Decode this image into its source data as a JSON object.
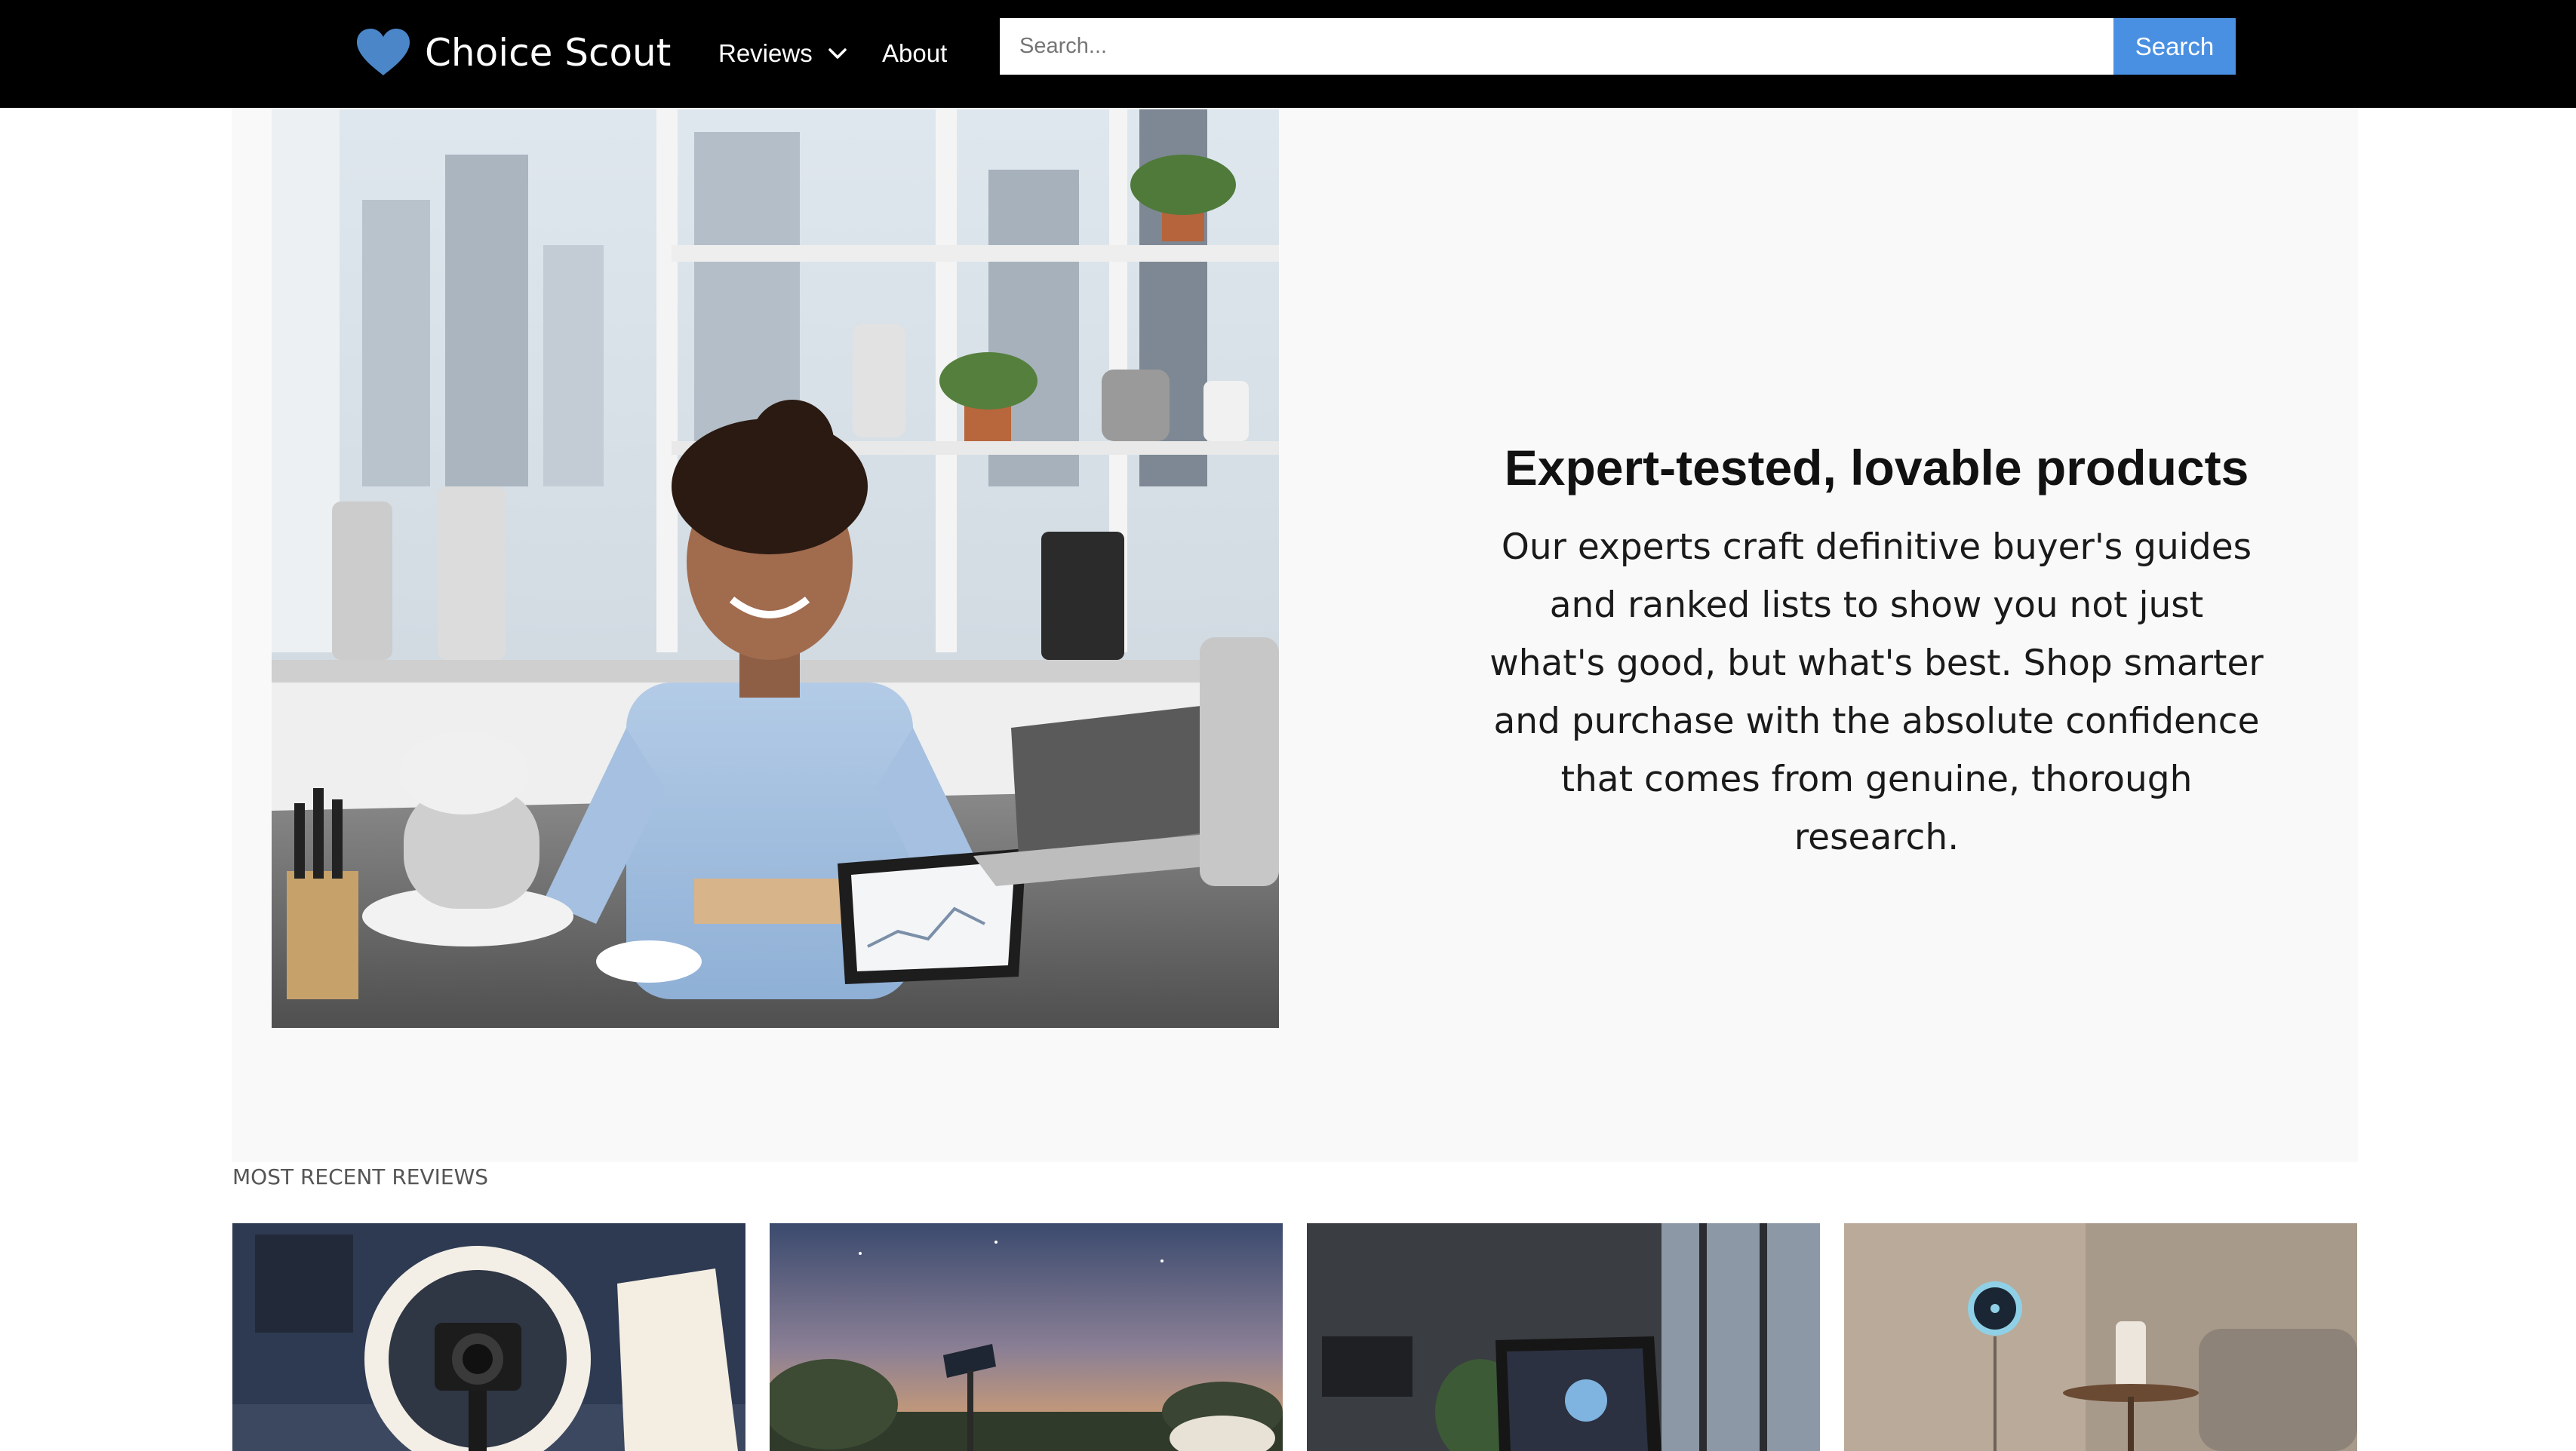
{
  "brand": {
    "name": "Choice Scout",
    "logo_icon": "heart-icon",
    "logo_color": "#4a86c8"
  },
  "nav": {
    "reviews_label": "Reviews",
    "reviews_icon": "chevron-down-icon",
    "about_label": "About"
  },
  "search": {
    "placeholder": "Search...",
    "value": "",
    "button_label": "Search",
    "button_color": "#4a90e2"
  },
  "hero": {
    "title": "Expert-tested, lovable products",
    "body": "Our experts craft definitive buyer's guides and ranked lists to show you not just what's good, but what's best. Shop smarter and purchase with the absolute confidence that comes from genuine, thorough research.",
    "image_subject": "smiling woman in blue shirt at a kitchen counter with mixer, knives, blenders, laptop and tablet"
  },
  "recent_reviews": {
    "heading": "MOST RECENT REVIEWS",
    "cards": [
      {
        "subject": "ring light with camera and LED panel"
      },
      {
        "subject": "solar garden light at dusk"
      },
      {
        "subject": "tablet showing smart home app in modern apartment"
      },
      {
        "subject": "smart thermostat on wall in living room"
      }
    ]
  },
  "colors": {
    "topbar": "#000000",
    "hero_background": "#f9f9f9",
    "accent": "#4a90e2"
  }
}
